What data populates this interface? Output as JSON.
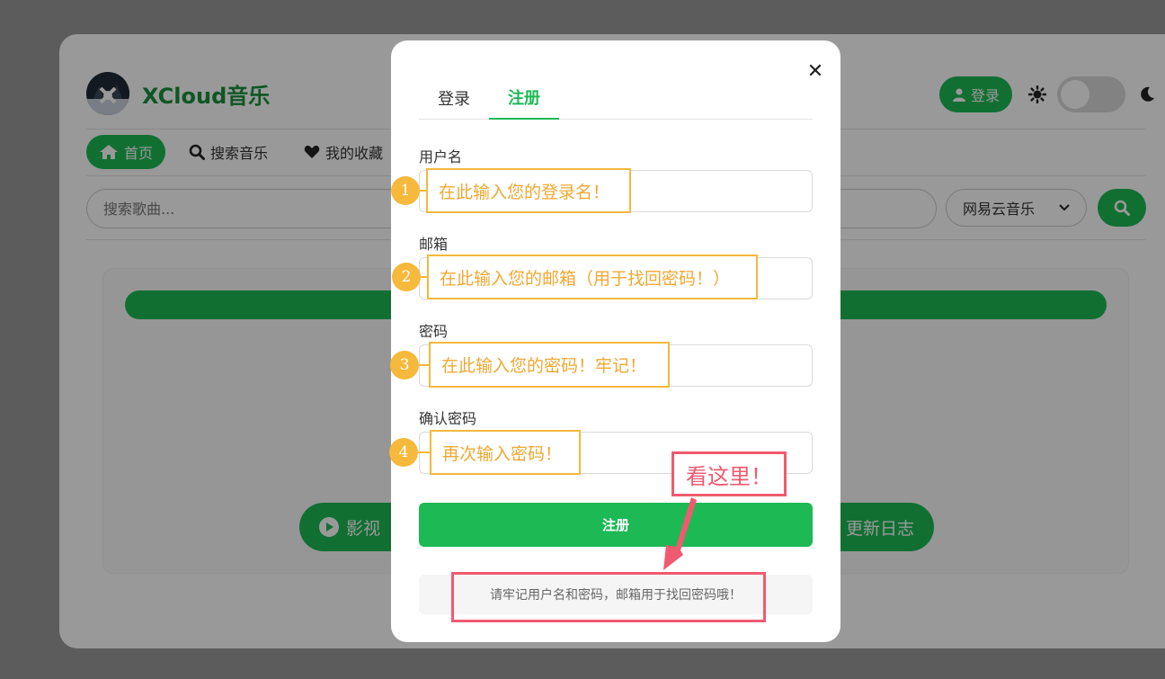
{
  "app": {
    "brand_name": "XCloud音乐",
    "login_label": "登录",
    "nav": [
      {
        "label": "首页"
      },
      {
        "label": "搜索音乐"
      },
      {
        "label": "我的收藏"
      }
    ],
    "search_placeholder": "搜索歌曲...",
    "source_selected": "网易云音乐",
    "btn_video": "影视",
    "btn_changelog": "更新日志",
    "colors": {
      "accent": "#1db954",
      "brand_text": "#1a8f3c"
    }
  },
  "modal": {
    "tabs": [
      {
        "label": "登录"
      },
      {
        "label": "注册"
      }
    ],
    "active_tab": "注册",
    "fields": [
      {
        "label": "用户名",
        "annotation": "在此输入您的登录名！",
        "num": "1"
      },
      {
        "label": "邮箱",
        "annotation": "在此输入您的邮箱（用于找回密码！）",
        "num": "2"
      },
      {
        "label": "密码",
        "annotation": "在此输入您的密码！牢记！",
        "num": "3"
      },
      {
        "label": "确认密码",
        "annotation": "再次输入密码！",
        "num": "4"
      }
    ],
    "submit_label": "注册",
    "note": "请牢记用户名和密码，邮箱用于找回密码哦！",
    "callout": "看这里！"
  }
}
